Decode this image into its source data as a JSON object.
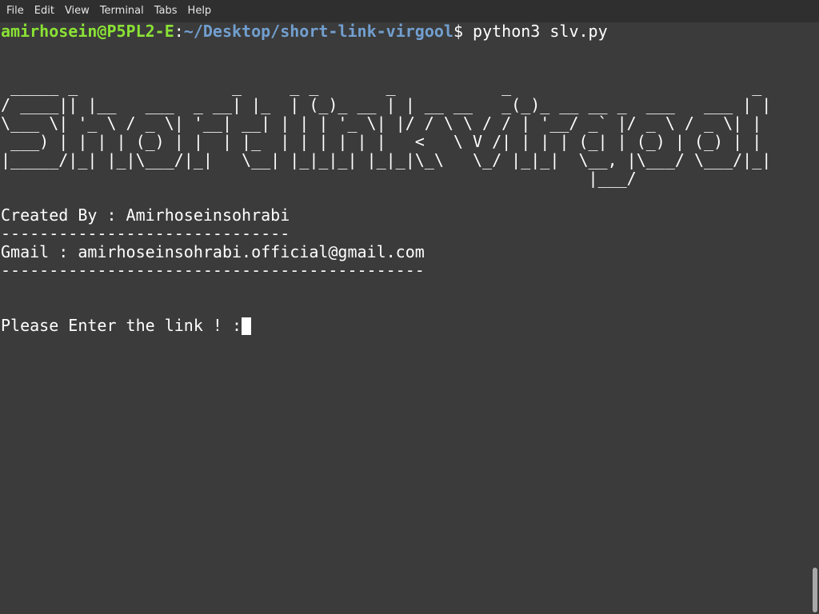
{
  "menu": {
    "items": [
      "File",
      "Edit",
      "View",
      "Terminal",
      "Tabs",
      "Help"
    ]
  },
  "prompt": {
    "user_host": "amirhosein@P5PL2-E",
    "separator": ":",
    "path": "~/Desktop/short-link-virgool",
    "symbol": "$ ",
    "command": "python3 slv.py"
  },
  "banner": {
    "lines": [
      " _____ _                _     _ _       _           _                         _ ",
      "/ ____|| |__   ___  _ __| |_  | (_)_ __ | | __ __   _(_)_ __ __ _  ___   ___ | |",
      "\\___ \\| '_ \\ / _ \\| '__| __| | | | '_ \\| |/ / \\ \\ / / | '__/ _` |/ _ \\ / _ \\| |",
      " ___) | | | | (_) | |  | |_  | | | | | |   <   \\ V /| | | | (_| | (_) | (_) | |",
      "|_____/|_| |_|\\___/|_|   \\__| |_|_|_| |_|_|\\_\\   \\_/ |_|_|  \\__, |\\___/ \\___/|_|",
      "                                                             |___/              "
    ]
  },
  "info": {
    "created_by": "Created By : Amirhoseinsohrabi",
    "divider1": "------------------------------",
    "gmail": "Gmail : amirhoseinsohrabi.official@gmail.com",
    "divider2": "--------------------------------------------"
  },
  "input_prompt": "Please Enter the link ! :",
  "colors": {
    "background": "#3b3b3b",
    "prompt_user": "#8ae234",
    "prompt_path": "#729fcf",
    "text": "#ffffff"
  }
}
